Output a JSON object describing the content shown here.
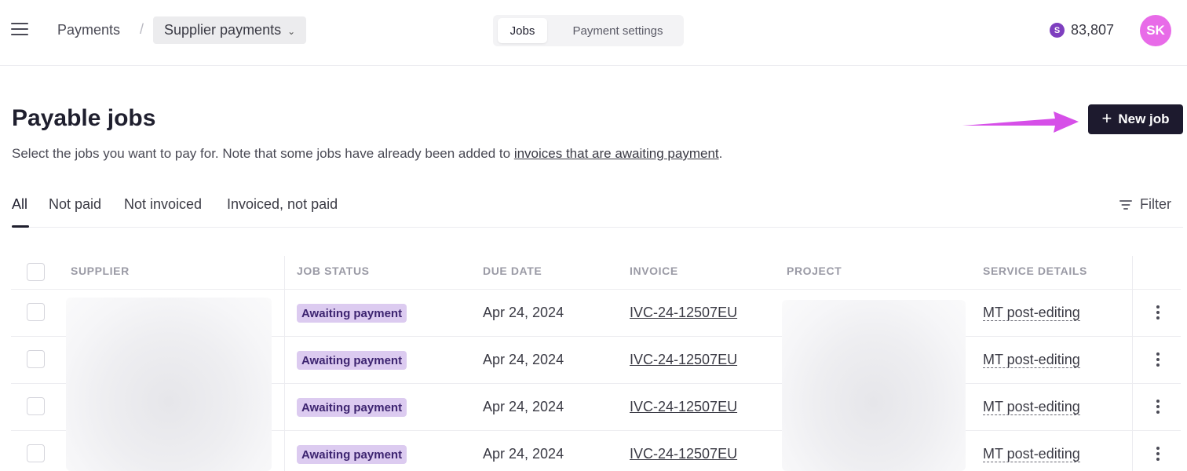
{
  "breadcrumb": {
    "root": "Payments",
    "separator": "/",
    "current": "Supplier payments"
  },
  "segmented": {
    "options": [
      "Jobs",
      "Payment settings"
    ],
    "active": "Jobs"
  },
  "credits": {
    "icon_letter": "S",
    "value": "83,807"
  },
  "user": {
    "initials": "SK"
  },
  "header": {
    "title": "Payable jobs",
    "subtitle_text": "Select the jobs you want to pay for. Note that some jobs have already been added to ",
    "subtitle_link": "invoices that are awaiting payment",
    "subtitle_end": ".",
    "new_job_label": "New job",
    "plus": "+"
  },
  "tabs": [
    "All",
    "Not paid",
    "Not invoiced",
    "Invoiced, not paid"
  ],
  "active_tab": "All",
  "filter_label": "Filter",
  "table": {
    "columns": [
      "SUPPLIER",
      "JOB STATUS",
      "DUE DATE",
      "INVOICE",
      "PROJECT",
      "SERVICE DETAILS"
    ],
    "rows": [
      {
        "status": "Awaiting payment",
        "due_date": "Apr 24, 2024",
        "invoice": "IVC-24-12507EU",
        "service": "MT post-editing"
      },
      {
        "status": "Awaiting payment",
        "due_date": "Apr 24, 2024",
        "invoice": "IVC-24-12507EU",
        "service": "MT post-editing"
      },
      {
        "status": "Awaiting payment",
        "due_date": "Apr 24, 2024",
        "invoice": "IVC-24-12507EU",
        "service": "MT post-editing"
      },
      {
        "status": "Awaiting payment",
        "due_date": "Apr 24, 2024",
        "invoice": "IVC-24-12507EU",
        "service": "MT post-editing"
      }
    ]
  },
  "colors": {
    "accent_dark": "#1d1a2e",
    "badge_bg": "#dccbf0",
    "badge_text": "#3d2470",
    "avatar": "#e86be8",
    "coin": "#7e3fbf",
    "annotation_arrow": "#d64fe8"
  }
}
